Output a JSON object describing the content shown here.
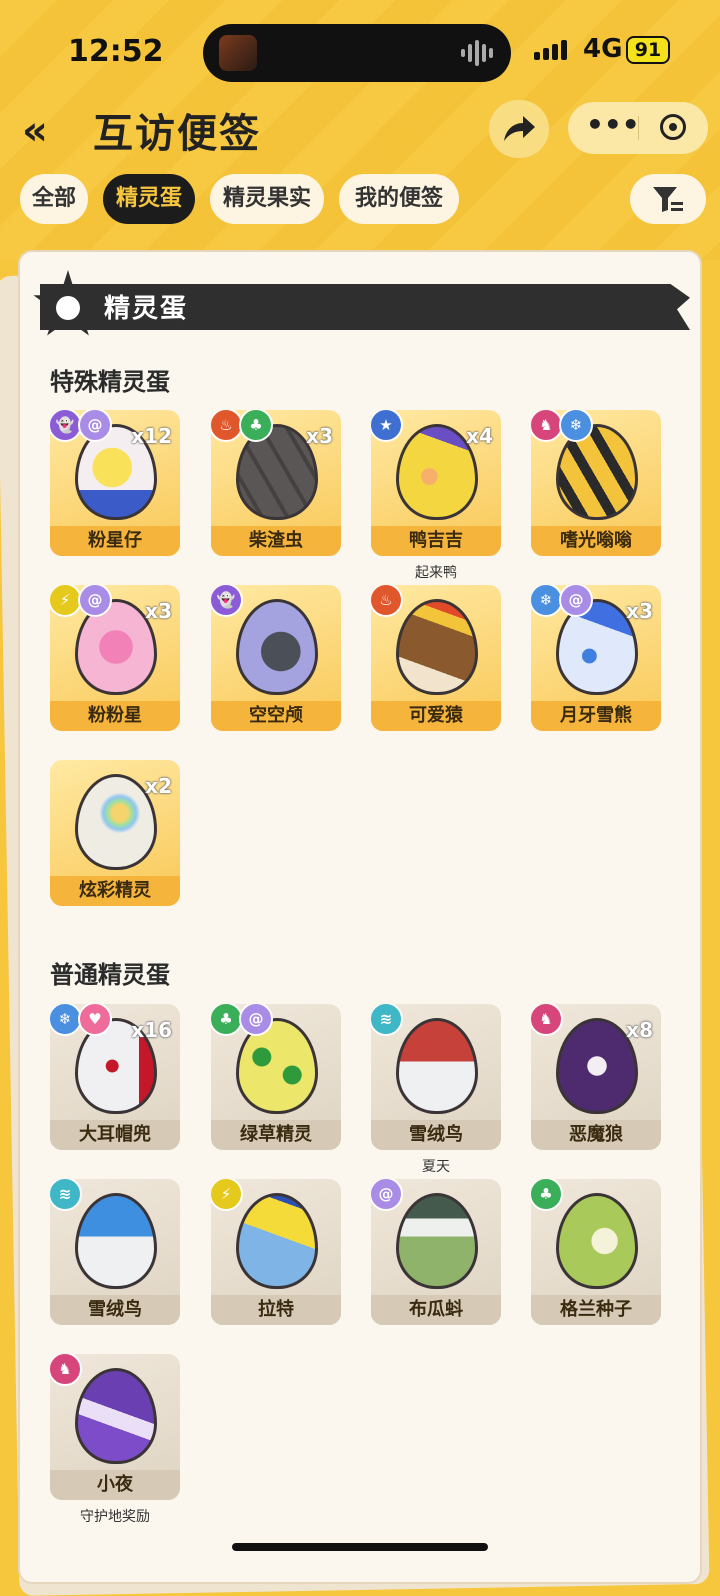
{
  "status": {
    "time": "12:52",
    "network": "4G",
    "battery": "91"
  },
  "header": {
    "back_icon": "«",
    "title": "互访便签",
    "share_icon": "share-arrow",
    "more_icon": "•••"
  },
  "tabs": [
    {
      "label": "全部",
      "active": false
    },
    {
      "label": "精灵蛋",
      "active": true
    },
    {
      "label": "精灵果实",
      "active": false
    },
    {
      "label": "我的便签",
      "active": false
    }
  ],
  "banner": {
    "title": "精灵蛋"
  },
  "sections": {
    "special": "特殊精灵蛋",
    "normal": "普通精灵蛋"
  },
  "special_eggs": [
    {
      "name": "粉星仔",
      "count": "x12",
      "sub": "",
      "badges": [
        "ghost",
        "swirl"
      ]
    },
    {
      "name": "柴渣虫",
      "count": "x3",
      "sub": "",
      "badges": [
        "fire",
        "leaf"
      ]
    },
    {
      "name": "鸭吉吉",
      "count": "x4",
      "sub": "起来鸭",
      "badges": [
        "star"
      ]
    },
    {
      "name": "嗜光嗡嗡",
      "count": "",
      "sub": "",
      "badges": [
        "demon",
        "ice"
      ]
    },
    {
      "name": "粉粉星",
      "count": "x3",
      "sub": "",
      "badges": [
        "bolt",
        "swirl"
      ]
    },
    {
      "name": "空空颅",
      "count": "",
      "sub": "",
      "badges": [
        "ghost"
      ]
    },
    {
      "name": "可爱猿",
      "count": "",
      "sub": "",
      "badges": [
        "fire"
      ]
    },
    {
      "name": "月牙雪熊",
      "count": "x3",
      "sub": "",
      "badges": [
        "ice",
        "swirl"
      ]
    },
    {
      "name": "炫彩精灵",
      "count": "x2",
      "sub": "",
      "badges": []
    }
  ],
  "normal_eggs": [
    {
      "name": "大耳帽兜",
      "count": "x16",
      "sub": "",
      "badges": [
        "ice",
        "heart"
      ]
    },
    {
      "name": "绿草精灵",
      "count": "",
      "sub": "",
      "badges": [
        "leaf",
        "swirl"
      ]
    },
    {
      "name": "雪绒鸟",
      "count": "",
      "sub": "夏天",
      "badges": [
        "wing"
      ]
    },
    {
      "name": "恶魔狼",
      "count": "x8",
      "sub": "",
      "badges": [
        "demon"
      ]
    },
    {
      "name": "雪绒鸟",
      "count": "",
      "sub": "",
      "badges": [
        "wing"
      ]
    },
    {
      "name": "拉特",
      "count": "",
      "sub": "",
      "badges": [
        "bolt"
      ]
    },
    {
      "name": "布瓜蚪",
      "count": "",
      "sub": "",
      "badges": [
        "swirl"
      ]
    },
    {
      "name": "格兰种子",
      "count": "",
      "sub": "",
      "badges": [
        "leaf"
      ]
    },
    {
      "name": "小夜",
      "count": "",
      "sub": "守护地奖励",
      "badges": [
        "demon"
      ]
    }
  ],
  "colors": {
    "accent": "#f6c63d",
    "dark": "#1c1c1c"
  }
}
